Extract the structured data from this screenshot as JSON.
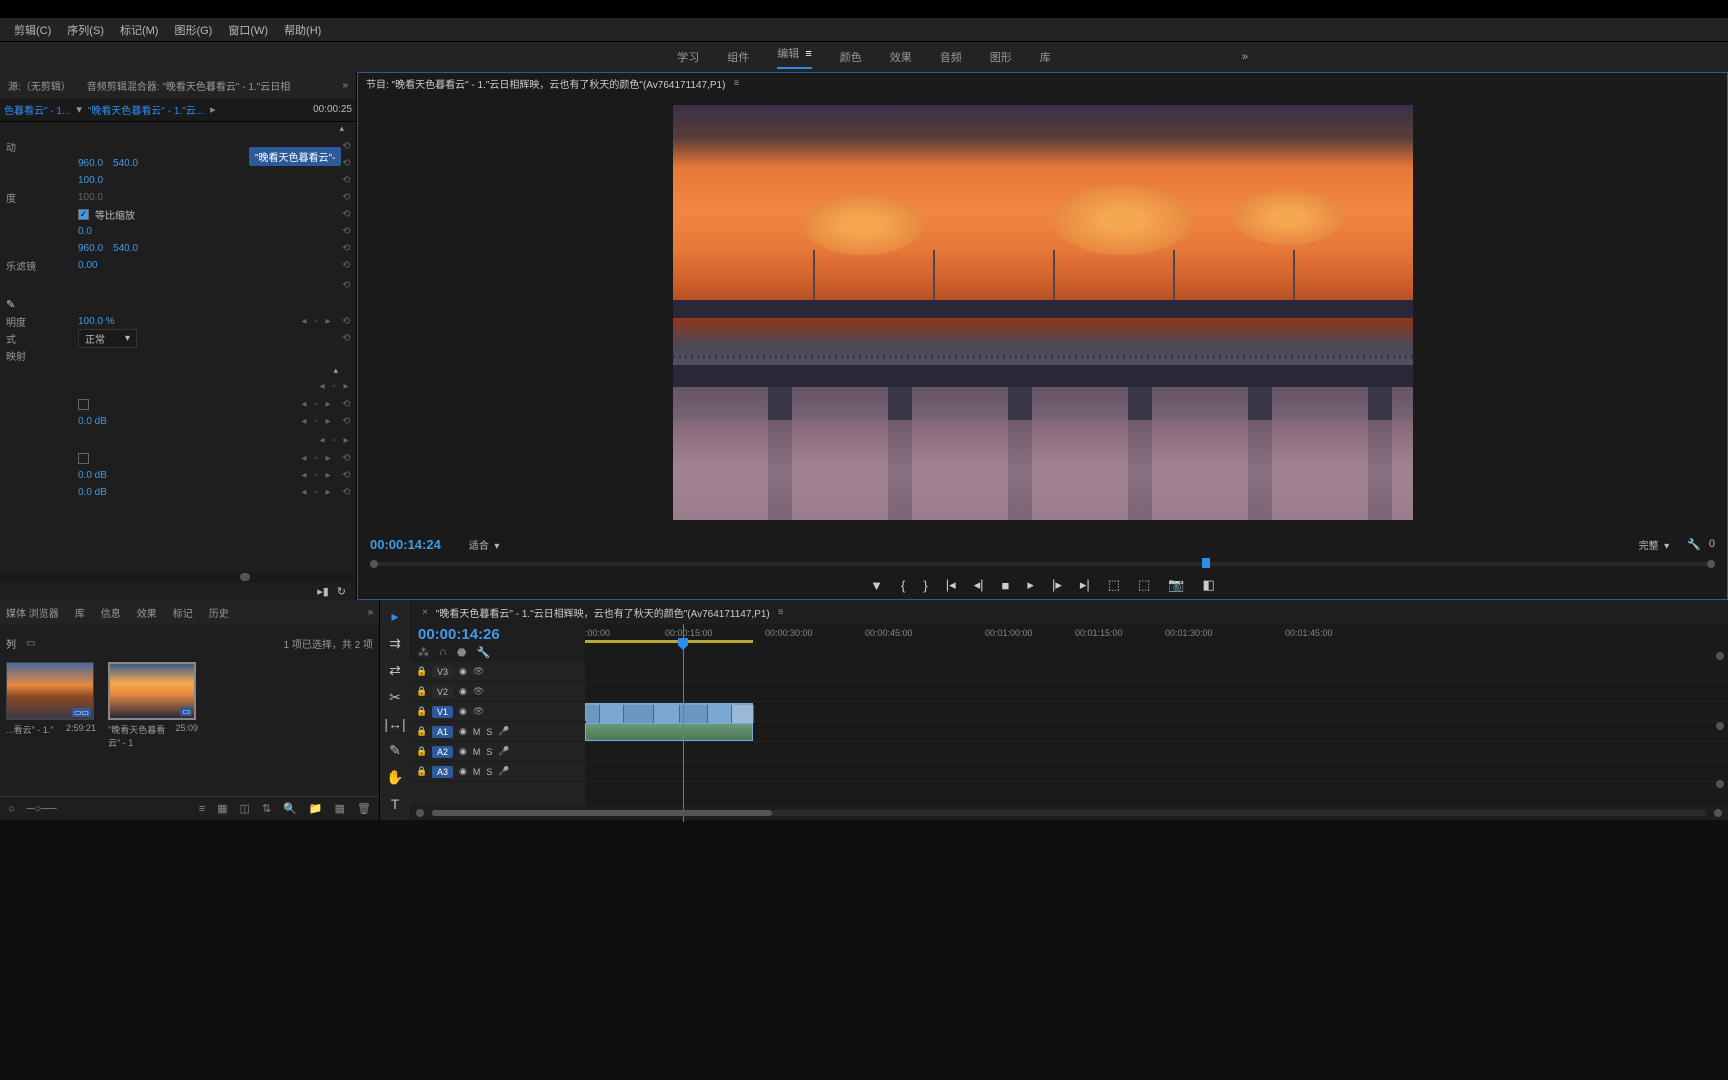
{
  "menu": {
    "edit": "剪辑(C)",
    "sequence": "序列(S)",
    "markers": "标记(M)",
    "graphics": "图形(G)",
    "window": "窗口(W)",
    "help": "帮助(H)"
  },
  "workspaces": {
    "learning": "学习",
    "components": "组件",
    "editing": "编辑",
    "color": "颜色",
    "effects": "效果",
    "audio": "音频",
    "graphics": "图形",
    "library": "库"
  },
  "source_panel": {
    "tab1": "源:（无剪辑）",
    "tab2": "音频剪辑混合器: \"晚看天色暮看云\" - 1.\"云日相",
    "clip_name": "色暮看云\" - 1...",
    "clip_full": "\"晚看天色暮看云\" - 1.\"云...",
    "clip_badge": "\"晚看天色暮看云\"-",
    "timecode": "00:00:25"
  },
  "effects": {
    "motion_label": "动",
    "pos_x": "960.0",
    "pos_y": "540.0",
    "scale": "100.0",
    "scale_w_label": "度",
    "scale_w": "100.0",
    "uniform_label": "等比缩放",
    "rotation": "0.0",
    "anchor_x": "960.0",
    "anchor_y": "540.0",
    "anti_flicker_label": "乐滤镜",
    "anti_flicker": "0.00",
    "opacity_label": "明度",
    "opacity": "100.0 %",
    "blend_label": "式",
    "blend_mode": "正常",
    "remap_label": "映射",
    "level1": "0.0 dB",
    "level2": "0.0 dB",
    "level3": "0.0 dB"
  },
  "program": {
    "title": "节目: \"晚看天色暮看云\" - 1.\"云日相辉映，云也有了秋天的颜色\"(Av764171147,P1)",
    "timecode": "00:00:14:24",
    "fit": "适合",
    "resolution": "完整",
    "zoom": "0"
  },
  "project": {
    "tabs": {
      "media": "媒体 浏览器",
      "library": "库",
      "info": "信息",
      "effects": "效果",
      "markers": "标记",
      "history": "历史"
    },
    "bin_label": "列",
    "status": "1 项已选择，共 2 项",
    "thumbs": [
      {
        "name": "...看云\" - 1.\"",
        "duration": "2:59:21"
      },
      {
        "name": "\"晚看天色暮看云\" - 1",
        "duration": "25:09"
      }
    ]
  },
  "timeline": {
    "title": "\"晚看天色暮看云\" - 1.\"云日相辉映，云也有了秋天的颜色\"(Av764171147,P1)",
    "timecode": "00:00:14:26",
    "ruler": [
      ":00:00",
      "00:00:15:00",
      "00:00:30:00",
      "00:00:45:00",
      "00:01:00:00",
      "00:01:15:00",
      "00:01:30:00",
      "00:01:45:00"
    ],
    "tracks": {
      "v3": "V3",
      "v2": "V2",
      "v1": "V1",
      "a1": "A1",
      "a2": "A2",
      "a3": "A3",
      "m": "M",
      "s": "S"
    }
  }
}
